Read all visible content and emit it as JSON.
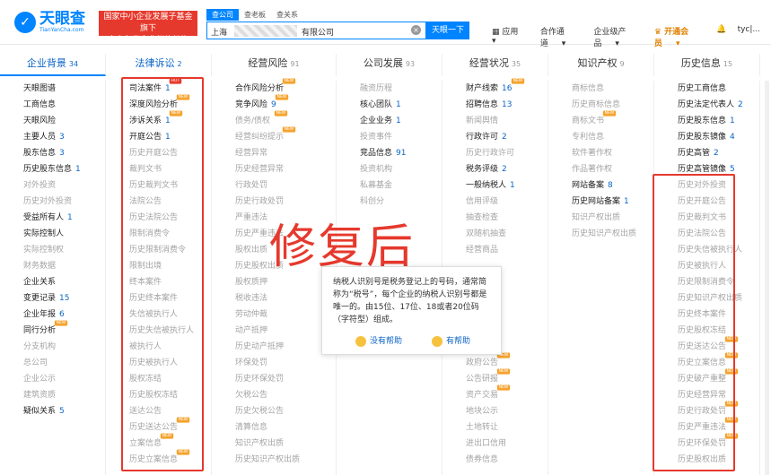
{
  "header": {
    "logo_cn": "天眼查",
    "logo_en": "TianYanCha.com",
    "badge_line1": "国家中小企业发展子基金旗下",
    "badge_line2": "官方备案企业征信机构",
    "search_tabs": [
      "查公司",
      "查老板",
      "查关系"
    ],
    "search_prefix": "上海",
    "search_suffix": "有限公司",
    "search_button": "天眼一下",
    "nav": [
      "应用",
      "合作通道",
      "企业级产品",
      "开通会员",
      "tyc|..."
    ]
  },
  "tabs": [
    {
      "label": "企业背景",
      "count": "34"
    },
    {
      "label": "法律诉讼",
      "count": "2"
    },
    {
      "label": "经营风险",
      "count": "91"
    },
    {
      "label": "公司发展",
      "count": "93"
    },
    {
      "label": "经营状况",
      "count": "35"
    },
    {
      "label": "知识产权",
      "count": "9"
    },
    {
      "label": "历史信息",
      "count": "15"
    }
  ],
  "columns": [
    [
      {
        "t": "天眼图谱",
        "on": true
      },
      {
        "t": "工商信息",
        "on": true
      },
      {
        "t": "天眼风险",
        "on": true
      },
      {
        "t": "主要人员",
        "on": true,
        "n": "3"
      },
      {
        "t": "股东信息",
        "on": true,
        "n": "3"
      },
      {
        "t": "历史股东信息",
        "on": true,
        "n": "1"
      },
      {
        "t": "对外投资",
        "on": false
      },
      {
        "t": "历史对外投资",
        "on": false
      },
      {
        "t": "受益所有人",
        "on": true,
        "n": "1"
      },
      {
        "t": "实际控制人",
        "on": true
      },
      {
        "t": "实际控制权",
        "on": false
      },
      {
        "t": "财务数据",
        "on": false
      },
      {
        "t": "企业关系",
        "on": true
      },
      {
        "t": "变更记录",
        "on": true,
        "n": "15"
      },
      {
        "t": "企业年报",
        "on": true,
        "n": "6"
      },
      {
        "t": "同行分析",
        "on": true,
        "tag": "NEW"
      },
      {
        "t": "分支机构",
        "on": false
      },
      {
        "t": "总公司",
        "on": false
      },
      {
        "t": "企业公示",
        "on": false
      },
      {
        "t": "建筑资质",
        "on": false
      },
      {
        "t": "疑似关系",
        "on": true,
        "n": "5"
      }
    ],
    [
      {
        "t": "司法案件",
        "on": true,
        "n": "1",
        "tag": "HOT",
        "hot": true
      },
      {
        "t": "深度风险分析",
        "on": true,
        "tag": "NEW"
      },
      {
        "t": "涉诉关系",
        "on": true,
        "n": "1",
        "tag": "NEW"
      },
      {
        "t": "开庭公告",
        "on": true,
        "n": "1"
      },
      {
        "t": "历史开庭公告",
        "on": false
      },
      {
        "t": "裁判文书",
        "on": false
      },
      {
        "t": "历史裁判文书",
        "on": false
      },
      {
        "t": "法院公告",
        "on": false
      },
      {
        "t": "历史法院公告",
        "on": false
      },
      {
        "t": "限制消费令",
        "on": false
      },
      {
        "t": "历史限制消费令",
        "on": false
      },
      {
        "t": "限制出境",
        "on": false
      },
      {
        "t": "终本案件",
        "on": false
      },
      {
        "t": "历史终本案件",
        "on": false
      },
      {
        "t": "失信被执行人",
        "on": false
      },
      {
        "t": "历史失信被执行人",
        "on": false
      },
      {
        "t": "被执行人",
        "on": false
      },
      {
        "t": "历史被执行人",
        "on": false
      },
      {
        "t": "股权冻结",
        "on": false
      },
      {
        "t": "历史股权冻结",
        "on": false
      },
      {
        "t": "送达公告",
        "on": false
      },
      {
        "t": "历史送达公告",
        "on": false,
        "tag": "NEW"
      },
      {
        "t": "立案信息",
        "on": false,
        "tag": "NEW"
      },
      {
        "t": "历史立案信息",
        "on": false,
        "tag": "NEW"
      }
    ],
    [
      {
        "t": "合作风险分析",
        "on": true,
        "tag": "NEW"
      },
      {
        "t": "竞争风险",
        "on": true,
        "n": "9",
        "tag": "NEW"
      },
      {
        "t": "债务/债权",
        "on": false,
        "tag": "NEW"
      },
      {
        "t": "经营纠纷提示",
        "on": false,
        "tag": "NEW"
      },
      {
        "t": "经营异常",
        "on": false
      },
      {
        "t": "历史经营异常",
        "on": false
      },
      {
        "t": "行政处罚",
        "on": false
      },
      {
        "t": "历史行政处罚",
        "on": false
      },
      {
        "t": "严重违法",
        "on": false
      },
      {
        "t": "历史严重违法",
        "on": false
      },
      {
        "t": "股权出质",
        "on": false
      },
      {
        "t": "历史股权出质",
        "on": false
      },
      {
        "t": "股权质押",
        "on": false
      },
      {
        "t": "税收违法",
        "on": false
      },
      {
        "t": "劳动仲裁",
        "on": false
      },
      {
        "t": "动产抵押",
        "on": false
      },
      {
        "t": "历史动产抵押",
        "on": false
      },
      {
        "t": "环保处罚",
        "on": false
      },
      {
        "t": "历史环保处罚",
        "on": false
      },
      {
        "t": "欠税公告",
        "on": false
      },
      {
        "t": "历史欠税公告",
        "on": false
      },
      {
        "t": "清算信息",
        "on": false
      },
      {
        "t": "知识产权出质",
        "on": false
      },
      {
        "t": "历史知识产权出质",
        "on": false
      }
    ],
    [
      {
        "t": "融资历程",
        "on": false
      },
      {
        "t": "核心团队",
        "on": true,
        "n": "1"
      },
      {
        "t": "企业业务",
        "on": true,
        "n": "1"
      },
      {
        "t": "投资事件",
        "on": false
      },
      {
        "t": "竞品信息",
        "on": true,
        "n": "91"
      },
      {
        "t": "投资机构",
        "on": false
      },
      {
        "t": "私募基金",
        "on": false
      },
      {
        "t": "科创分",
        "on": false
      }
    ],
    [
      {
        "t": "财产线索",
        "on": true,
        "n": "16",
        "tag": "NEW"
      },
      {
        "t": "招聘信息",
        "on": true,
        "n": "13"
      },
      {
        "t": "新闻舆情",
        "on": false
      },
      {
        "t": "行政许可",
        "on": true,
        "n": "2"
      },
      {
        "t": "历史行政许可",
        "on": false
      },
      {
        "t": "税务评级",
        "on": true,
        "n": "2"
      },
      {
        "t": "一般纳税人",
        "on": true,
        "n": "1"
      },
      {
        "t": "信用评级",
        "on": false
      },
      {
        "t": "抽查检查",
        "on": false
      },
      {
        "t": "双随机抽查",
        "on": false
      },
      {
        "t": "经营商品",
        "on": false
      },
      {
        "t": "",
        "on": false
      },
      {
        "t": "",
        "on": false
      },
      {
        "t": "",
        "on": false
      },
      {
        "t": "",
        "on": false
      },
      {
        "t": "",
        "on": false
      },
      {
        "t": "",
        "on": false
      },
      {
        "t": "政府公告",
        "on": false,
        "tag": "NEW"
      },
      {
        "t": "公告研报",
        "on": false,
        "tag": "NEW"
      },
      {
        "t": "资产交易",
        "on": false,
        "tag": "NEW"
      },
      {
        "t": "地块公示",
        "on": false
      },
      {
        "t": "土地转让",
        "on": false
      },
      {
        "t": "进出口信用",
        "on": false
      },
      {
        "t": "债券信息",
        "on": false
      }
    ],
    [
      {
        "t": "商标信息",
        "on": false
      },
      {
        "t": "历史商标信息",
        "on": false
      },
      {
        "t": "商标文书",
        "on": false,
        "tag": "NEW"
      },
      {
        "t": "专利信息",
        "on": false
      },
      {
        "t": "软件著作权",
        "on": false
      },
      {
        "t": "作品著作权",
        "on": false
      },
      {
        "t": "网站备案",
        "on": true,
        "n": "8"
      },
      {
        "t": "历史网站备案",
        "on": true,
        "n": "1"
      },
      {
        "t": "知识产权出质",
        "on": false
      },
      {
        "t": "历史知识产权出质",
        "on": false
      }
    ],
    [
      {
        "t": "历史工商信息",
        "on": true
      },
      {
        "t": "历史法定代表人",
        "on": true,
        "n": "2"
      },
      {
        "t": "历史股东信息",
        "on": true,
        "n": "1"
      },
      {
        "t": "历史股东镜像",
        "on": true,
        "n": "4"
      },
      {
        "t": "历史高管",
        "on": true,
        "n": "2"
      },
      {
        "t": "历史高管镜像",
        "on": true,
        "n": "5"
      },
      {
        "t": "历史对外投资",
        "on": false
      },
      {
        "t": "历史开庭公告",
        "on": false
      },
      {
        "t": "历史裁判文书",
        "on": false
      },
      {
        "t": "历史法院公告",
        "on": false
      },
      {
        "t": "历史失信被执行人",
        "on": false
      },
      {
        "t": "历史被执行人",
        "on": false
      },
      {
        "t": "历史限制消费令",
        "on": false
      },
      {
        "t": "历史知识产权出质",
        "on": false
      },
      {
        "t": "历史终本案件",
        "on": false
      },
      {
        "t": "历史股权冻结",
        "on": false
      },
      {
        "t": "历史送达公告",
        "on": false,
        "tag": "NEW"
      },
      {
        "t": "历史立案信息",
        "on": false,
        "tag": "NEW"
      },
      {
        "t": "历史破产重整",
        "on": false,
        "tag": "NEW"
      },
      {
        "t": "历史经营异常",
        "on": false
      },
      {
        "t": "历史行政处罚",
        "on": false,
        "tag": "NEW"
      },
      {
        "t": "历史严重违法",
        "on": false,
        "tag": "NEW"
      },
      {
        "t": "历史环保处罚",
        "on": false,
        "tag": "NEW"
      },
      {
        "t": "历史股权出质",
        "on": false
      }
    ]
  ],
  "overlay_text": "修复后",
  "tooltip": {
    "body": "纳税人识别号是税务登记上的号码，通常简称为“税号”，每个企业的纳税人识别号都是唯一的。由15位、17位、18或者20位码（字符型）组成。",
    "no_help": "没有帮助",
    "helpful": "有帮助"
  },
  "colors": {
    "accent": "#0084ff",
    "annotation": "#e6392d",
    "link": "#0c65c6"
  }
}
